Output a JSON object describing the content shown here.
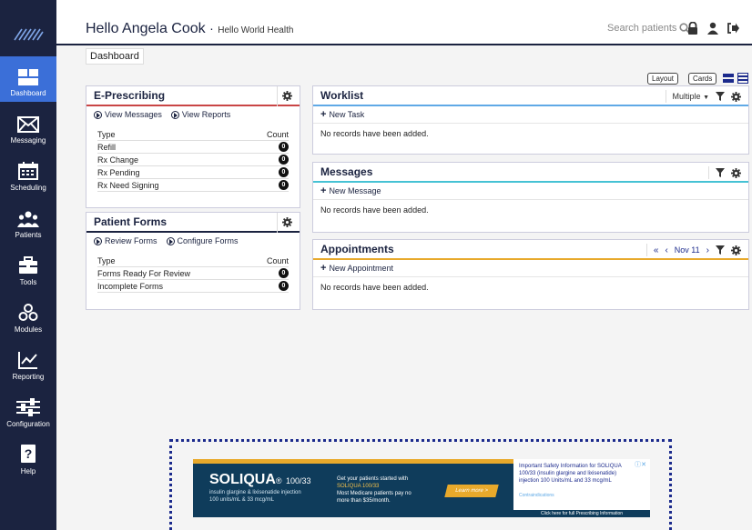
{
  "header": {
    "greeting": "Hello Angela Cook",
    "separator": "·",
    "organization": "Hello World Health",
    "search_label": "Search patients"
  },
  "breadcrumb": "Dashboard",
  "view_switch": {
    "layout_label": "Layout",
    "cards_label": "Cards"
  },
  "sidebar": {
    "items": [
      {
        "label": "Dashboard",
        "icon": "dashboard-icon"
      },
      {
        "label": "Messaging",
        "icon": "envelope-icon"
      },
      {
        "label": "Scheduling",
        "icon": "calendar-icon"
      },
      {
        "label": "Patients",
        "icon": "users-icon"
      },
      {
        "label": "Tools",
        "icon": "toolbox-icon"
      },
      {
        "label": "Modules",
        "icon": "cubes-icon"
      },
      {
        "label": "Reporting",
        "icon": "chart-icon"
      },
      {
        "label": "Configuration",
        "icon": "sliders-icon"
      },
      {
        "label": "Help",
        "icon": "help-icon"
      }
    ]
  },
  "eprescribing": {
    "title": "E-Prescribing",
    "view_messages": "View Messages",
    "view_reports": "View Reports",
    "col_type": "Type",
    "col_count": "Count",
    "rows": [
      {
        "type": "Refill",
        "count": "0"
      },
      {
        "type": "Rx Change",
        "count": "0"
      },
      {
        "type": "Rx Pending",
        "count": "0"
      },
      {
        "type": "Rx Need Signing",
        "count": "0"
      }
    ]
  },
  "patient_forms": {
    "title": "Patient Forms",
    "review_forms": "Review Forms",
    "configure_forms": "Configure Forms",
    "col_type": "Type",
    "col_count": "Count",
    "rows": [
      {
        "type": "Forms Ready For Review",
        "count": "0"
      },
      {
        "type": "Incomplete Forms",
        "count": "0"
      }
    ]
  },
  "worklist": {
    "title": "Worklist",
    "filter_value": "Multiple",
    "new_label": "New Task",
    "empty_text": "No records have been added."
  },
  "messages": {
    "title": "Messages",
    "new_label": "New Message",
    "empty_text": "No records have been added."
  },
  "appointments": {
    "title": "Appointments",
    "date_label": "Nov 11",
    "new_label": "New Appointment",
    "empty_text": "No records have been added."
  },
  "ad": {
    "brand": "SOLIQUA",
    "reg": "®",
    "dose": "100/33",
    "sub1": "insulin glargine & lixisenatide injection",
    "sub2": "100 units/mL & 33 mcg/mL",
    "mid1": "Get your patients started with",
    "mid2": "SOLIQUA 100/33",
    "mid3": "Most Medicare patients pay no",
    "mid4": "more than $35/month.",
    "cta": "Learn more >",
    "isi": "Important Safety Information for SOLIQUA 100/33 (insulin glargine and lixisenatide) injection 100 Units/mL and 33 mcg/mL",
    "contra": "Contraindications",
    "full_pi": "Click here for full Prescribing Information"
  }
}
